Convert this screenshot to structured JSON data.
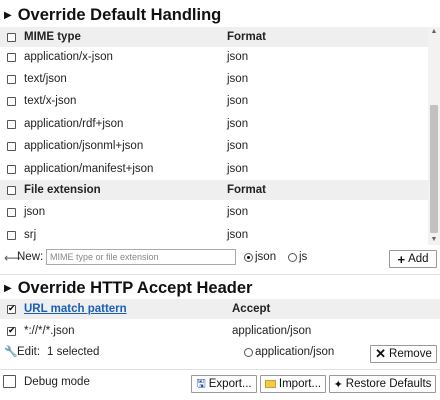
{
  "override_default": {
    "title": "Override Default Handling",
    "mime_header": {
      "col1": "MIME type",
      "col2": "Format"
    },
    "mime_rows": [
      {
        "type": "application/x-json",
        "format": "json"
      },
      {
        "type": "text/json",
        "format": "json"
      },
      {
        "type": "text/x-json",
        "format": "json"
      },
      {
        "type": "application/rdf+json",
        "format": "json"
      },
      {
        "type": "application/jsonml+json",
        "format": "json"
      },
      {
        "type": "application/manifest+json",
        "format": "json"
      }
    ],
    "ext_header": {
      "col1": "File extension",
      "col2": "Format"
    },
    "ext_rows": [
      {
        "ext": "json",
        "format": "json"
      },
      {
        "ext": "srj",
        "format": "json"
      }
    ],
    "new_label": "New:",
    "new_placeholder": "MIME type or file extension",
    "radio_json": "json",
    "radio_js": "js",
    "add_label": "Add"
  },
  "override_accept": {
    "title": "Override HTTP Accept Header",
    "col1": "URL match pattern",
    "col2": "Accept",
    "rows": [
      {
        "pattern": "*://*/*.json",
        "accept": "application/json"
      }
    ],
    "edit_label": "Edit:",
    "edit_value": "1 selected",
    "radio_label": "application/json",
    "remove_label": "Remove"
  },
  "footer": {
    "debug_label": "Debug mode",
    "export_label": "Export...",
    "import_label": "Import...",
    "restore_label": "Restore Defaults"
  }
}
